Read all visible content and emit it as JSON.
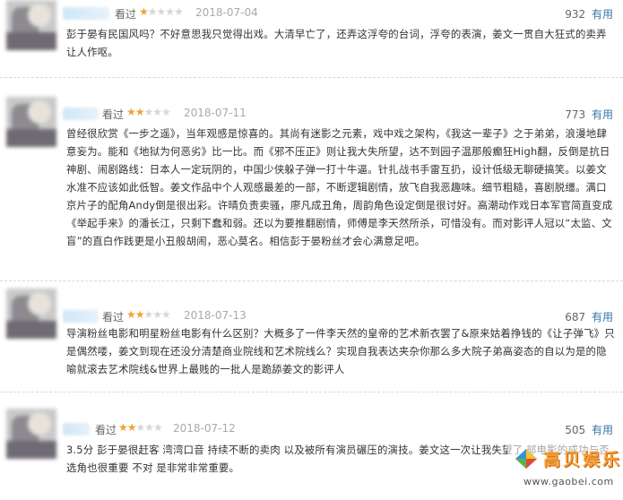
{
  "reviews": [
    {
      "seen_label": "看过",
      "rating": 1,
      "date": "2018-07-04",
      "votes": "932",
      "useful_label": "有用",
      "text": "彭于晏有民国风吗？不好意思我只觉得出戏。大清早亡了，还弄这浮夸的台词，浮夸的表演，姜文一贯自大狂式的卖弄让人作呕。"
    },
    {
      "seen_label": "看过",
      "rating": 2,
      "date": "2018-07-11",
      "votes": "773",
      "useful_label": "有用",
      "text": "曾经很欣赏《一步之遥》，当年观感是惊喜的。其尚有迷影之元素，戏中戏之架构，《我这一辈子》之于弟弟，浪漫地肆意妄为。能和《地狱为何恶劣》比一比。而《邪不压正》则让我大失所望，达不到园子温那般癫狂High翻，反倒是抗日神剧、闹剧路线：日本人一定玩阴的，中国少侠躲子弹一打十牛逼。针扎战书手雷互扔，设计低级无聊硬搞笑。以姜文水准不应该如此低智。姜文作品中个人观感最差的一部，不断逻辑剧情，放飞自我恶趣味。细节粗糙，喜剧脱缰。满口京片子的配角Andy倒是很出彩。许晴负责卖骚，廖凡成丑角，周韵角色设定倒是很讨好。高潮动作戏日本军官简直变成《举起手来》的潘长江，只剩下蠢和弱。还以为要推翻剧情，师傅是李天然所杀，可惜没有。而对影评人冠以“太监、文盲”的直白作践更是小丑般胡闹，恶心莫名。相信彭于晏粉丝才会心满意足吧。"
    },
    {
      "seen_label": "看过",
      "rating": 2,
      "date": "2018-07-13",
      "votes": "687",
      "useful_label": "有用",
      "text": "导演粉丝电影和明星粉丝电影有什么区别？大概多了一件李天然的皇帝的艺术新衣罢了&原来姑着挣钱的《让子弹飞》只是偶然喽，姜文到现在还没分清楚商业院线和艺术院线么？实现自我表达夹杂你那么多大院子弟高姿态的自以为是的隐喻就滚去艺术院线&世界上最贱的一批人是跪舔姜文的影评人"
    },
    {
      "seen_label": "看过",
      "rating": 2,
      "date": "2018-07-12",
      "votes": "505",
      "useful_label": "有用",
      "text": "3.5分 彭于晏很赶客 湾湾口音 持续不断的卖肉 以及被所有演员碾压的演技。姜文这一次让我失望了 部电影的成功与否 选角也很重要 不对 是非常非常重要。"
    }
  ],
  "watermark": {
    "logo_text": "高贝娱乐",
    "url": "www.gaobei.com"
  },
  "colors": {
    "star_on": "#f2a230",
    "star_off": "#d6d6d6",
    "useful_link": "#3377aa",
    "date": "#aaaaaa"
  }
}
